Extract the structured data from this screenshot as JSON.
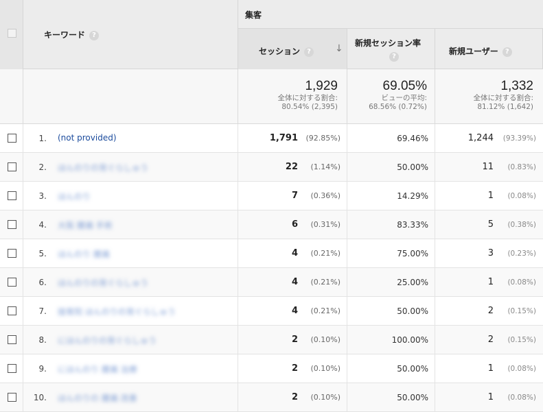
{
  "header": {
    "group_label": "集客",
    "keyword_label": "キーワード",
    "sessions_label": "セッション",
    "new_session_rate_label": "新規セッション率",
    "new_users_label": "新規ユーザー",
    "help_glyph": "?",
    "sort_arrow": "↓"
  },
  "totals": {
    "sessions": {
      "value": "1,929",
      "line1": "全体に対する割合:",
      "line2": "80.54% (2,395)"
    },
    "new_session_rate": {
      "value": "69.05%",
      "line1": "ビューの平均:",
      "line2": "68.56% (0.72%)"
    },
    "new_users": {
      "value": "1,332",
      "line1": "全体に対する割合:",
      "line2": "81.12% (1,642)"
    }
  },
  "rows": [
    {
      "num": "1.",
      "keyword": "(not provided)",
      "blurred": false,
      "sessions": "1,791",
      "sessions_pct": "(92.85%)",
      "rate": "69.46%",
      "users": "1,244",
      "users_pct": "(93.39%)"
    },
    {
      "num": "2.",
      "keyword": "ほんのりの背ぐらしゅう",
      "blurred": true,
      "sessions": "22",
      "sessions_pct": "(1.14%)",
      "rate": "50.00%",
      "users": "11",
      "users_pct": "(0.83%)"
    },
    {
      "num": "3.",
      "keyword": "ほんのり",
      "blurred": true,
      "sessions": "7",
      "sessions_pct": "(0.36%)",
      "rate": "14.29%",
      "users": "1",
      "users_pct": "(0.08%)"
    },
    {
      "num": "4.",
      "keyword": "大阪 腰痛 手術",
      "blurred": true,
      "sessions": "6",
      "sessions_pct": "(0.31%)",
      "rate": "83.33%",
      "users": "5",
      "users_pct": "(0.38%)"
    },
    {
      "num": "5.",
      "keyword": "ほんのり 腰痛",
      "blurred": true,
      "sessions": "4",
      "sessions_pct": "(0.21%)",
      "rate": "75.00%",
      "users": "3",
      "users_pct": "(0.23%)"
    },
    {
      "num": "6.",
      "keyword": "ほんのりの背ぐらしゅう",
      "blurred": true,
      "sessions": "4",
      "sessions_pct": "(0.21%)",
      "rate": "25.00%",
      "users": "1",
      "users_pct": "(0.08%)"
    },
    {
      "num": "7.",
      "keyword": "接骨院 ほんのりの背ぐらしゅう",
      "blurred": true,
      "sessions": "4",
      "sessions_pct": "(0.21%)",
      "rate": "50.00%",
      "users": "2",
      "users_pct": "(0.15%)"
    },
    {
      "num": "8.",
      "keyword": "にほんのりの背ぐらしゅう",
      "blurred": true,
      "sessions": "2",
      "sessions_pct": "(0.10%)",
      "rate": "100.00%",
      "users": "2",
      "users_pct": "(0.15%)"
    },
    {
      "num": "9.",
      "keyword": "にほんのり 腰痛 治療",
      "blurred": true,
      "sessions": "2",
      "sessions_pct": "(0.10%)",
      "rate": "50.00%",
      "users": "1",
      "users_pct": "(0.08%)"
    },
    {
      "num": "10.",
      "keyword": "ほんのりの 腰痛 改善",
      "blurred": true,
      "sessions": "2",
      "sessions_pct": "(0.10%)",
      "rate": "50.00%",
      "users": "1",
      "users_pct": "(0.08%)"
    }
  ]
}
